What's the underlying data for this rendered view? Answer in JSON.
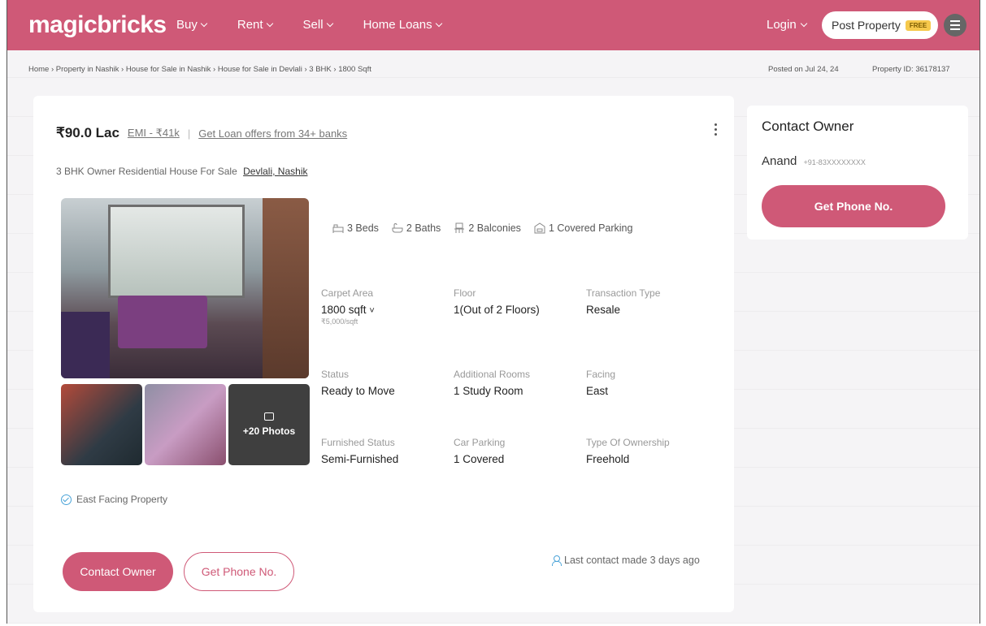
{
  "nav": {
    "logo": "magicbricks",
    "links": [
      "Buy",
      "Rent",
      "Sell",
      "Home Loans"
    ],
    "login": "Login",
    "post_property": "Post Property",
    "post_badge": "FREE"
  },
  "breadcrumb": {
    "path": "Home › Property in Nashik › House for Sale in Nashik › House for Sale in Devlali › 3 BHK › 1800 Sqft",
    "posted": "Posted on Jul 24, 24",
    "property_id": "Property ID: 36178137"
  },
  "listing": {
    "price": "₹90.0 Lac",
    "emi": "EMI - ₹41k",
    "separator": "|",
    "loan_offers": "Get Loan offers from 34+ banks",
    "subtitle": "3 BHK Owner Residential House For Sale",
    "location": "Devlali, Nashik",
    "more_photos": "+20 Photos",
    "amenities": [
      "3 Beds",
      "2 Baths",
      "2 Balconies",
      "1 Covered Parking"
    ],
    "facts": [
      {
        "label": "Carpet Area",
        "value": "1800 sqft",
        "sub": "₹5,000/sqft"
      },
      {
        "label": "Floor",
        "value": "1(Out of 2 Floors)"
      },
      {
        "label": "Transaction Type",
        "value": "Resale"
      },
      {
        "label": "Status",
        "value": "Ready to Move"
      },
      {
        "label": "Additional Rooms",
        "value": "1 Study Room"
      },
      {
        "label": "Facing",
        "value": "East"
      },
      {
        "label": "Furnished Status",
        "value": "Semi-Furnished"
      },
      {
        "label": "Car Parking",
        "value": "1 Covered"
      },
      {
        "label": "Type Of Ownership",
        "value": "Freehold"
      }
    ],
    "east_facing": "East Facing Property",
    "contact_owner_btn": "Contact Owner",
    "get_phone_btn": "Get Phone No.",
    "last_contact": "Last contact made 3 days ago"
  },
  "contact_panel": {
    "title": "Contact Owner",
    "owner": "Anand",
    "phone_masked": "+91-83XXXXXXXX",
    "button": "Get Phone No."
  },
  "colors": {
    "brand": "#cf5977",
    "link_blue": "#4aa3d8"
  }
}
